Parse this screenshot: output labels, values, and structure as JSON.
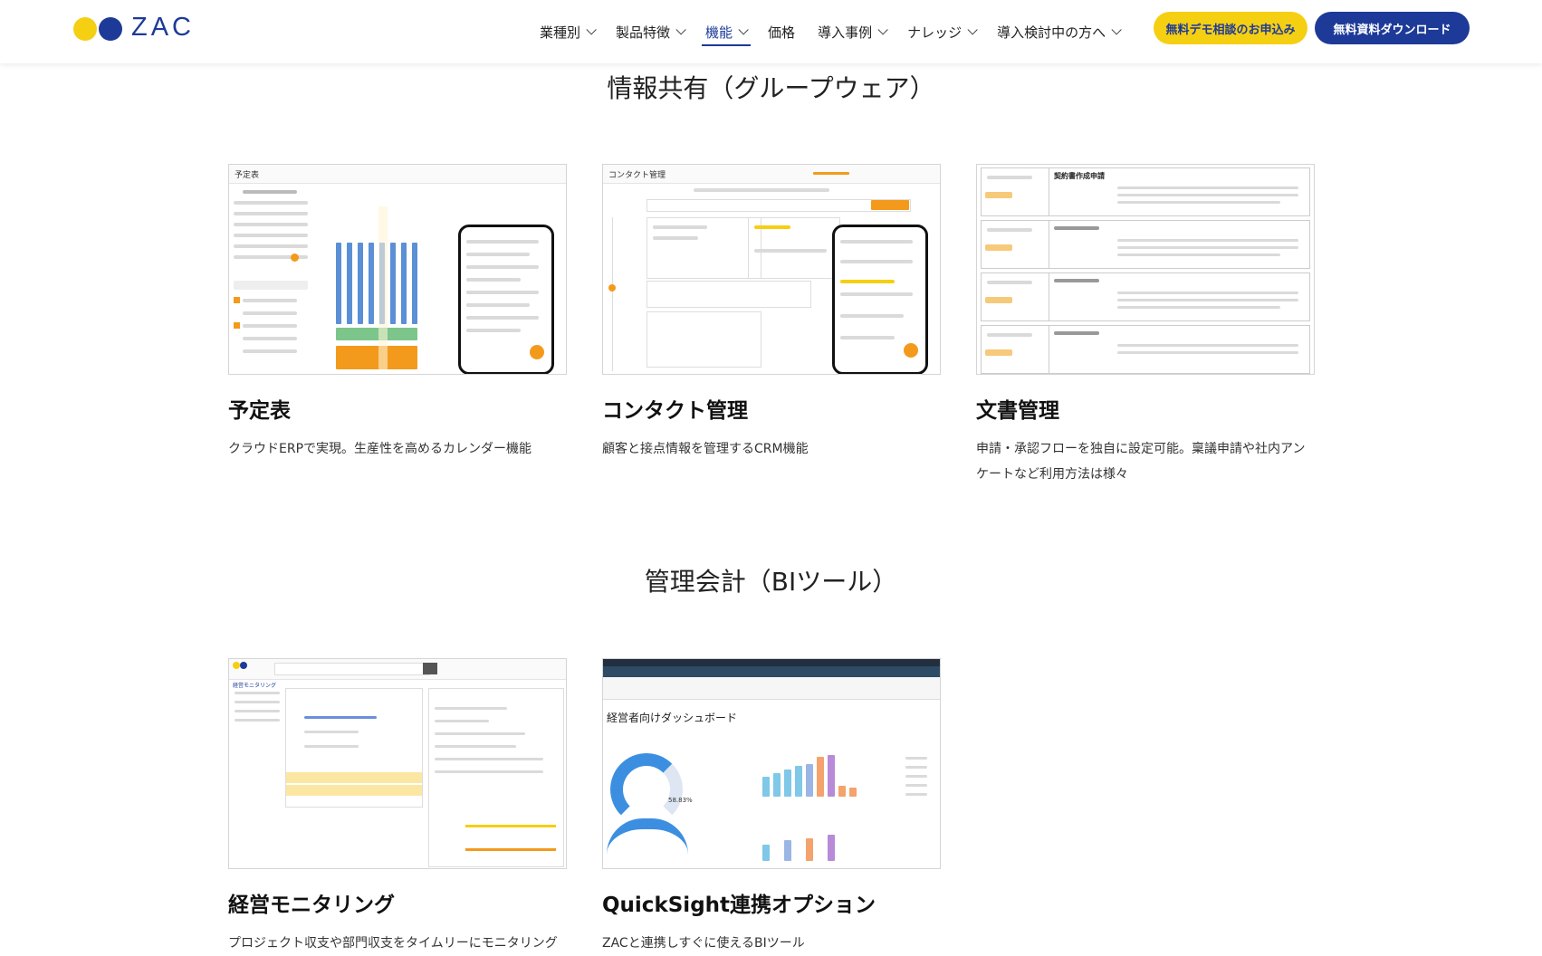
{
  "header": {
    "logo_text": "ZAC",
    "nav": [
      {
        "label": "業種別",
        "dropdown": true,
        "active": false
      },
      {
        "label": "製品特徴",
        "dropdown": true,
        "active": false
      },
      {
        "label": "機能",
        "dropdown": true,
        "active": true
      },
      {
        "label": "価格",
        "dropdown": false,
        "active": false
      },
      {
        "label": "導入事例",
        "dropdown": true,
        "active": false
      },
      {
        "label": "ナレッジ",
        "dropdown": true,
        "active": false
      },
      {
        "label": "導入検討中の方へ",
        "dropdown": true,
        "active": false
      }
    ],
    "demo_button": "無料デモ相談のお申込み",
    "download_button": "無料資料ダウンロード"
  },
  "sections": [
    {
      "title": "情報共有（グループウェア）",
      "cards": [
        {
          "title": "予定表",
          "desc": "クラウドERPで実現。生産性を高めるカレンダー機能",
          "thumb_label": "予定表"
        },
        {
          "title": "コンタクト管理",
          "desc": "顧客と接点情報を管理するCRM機能",
          "thumb_label": "コンタクト管理"
        },
        {
          "title": "文書管理",
          "desc": "申請・承認フローを独自に設定可能。稟議申請や社内アンケートなど利用方法は様々",
          "thumb_label": "契約書作成申請"
        }
      ]
    },
    {
      "title": "管理会計（BIツール）",
      "cards": [
        {
          "title": "経営モニタリング",
          "desc": "プロジェクト収支や部門収支をタイムリーにモニタリング",
          "thumb_label": "経営モニタリング"
        },
        {
          "title": "QuickSight連携オプション",
          "desc": "ZACと連携しすぐに使えるBIツール",
          "thumb_label": "経営者向けダッシュボード",
          "thumb_percent": "58.83%"
        }
      ]
    }
  ],
  "colors": {
    "brand_blue": "#1d3a98",
    "brand_yellow": "#f5cf12",
    "accent_orange": "#f39a1c"
  }
}
